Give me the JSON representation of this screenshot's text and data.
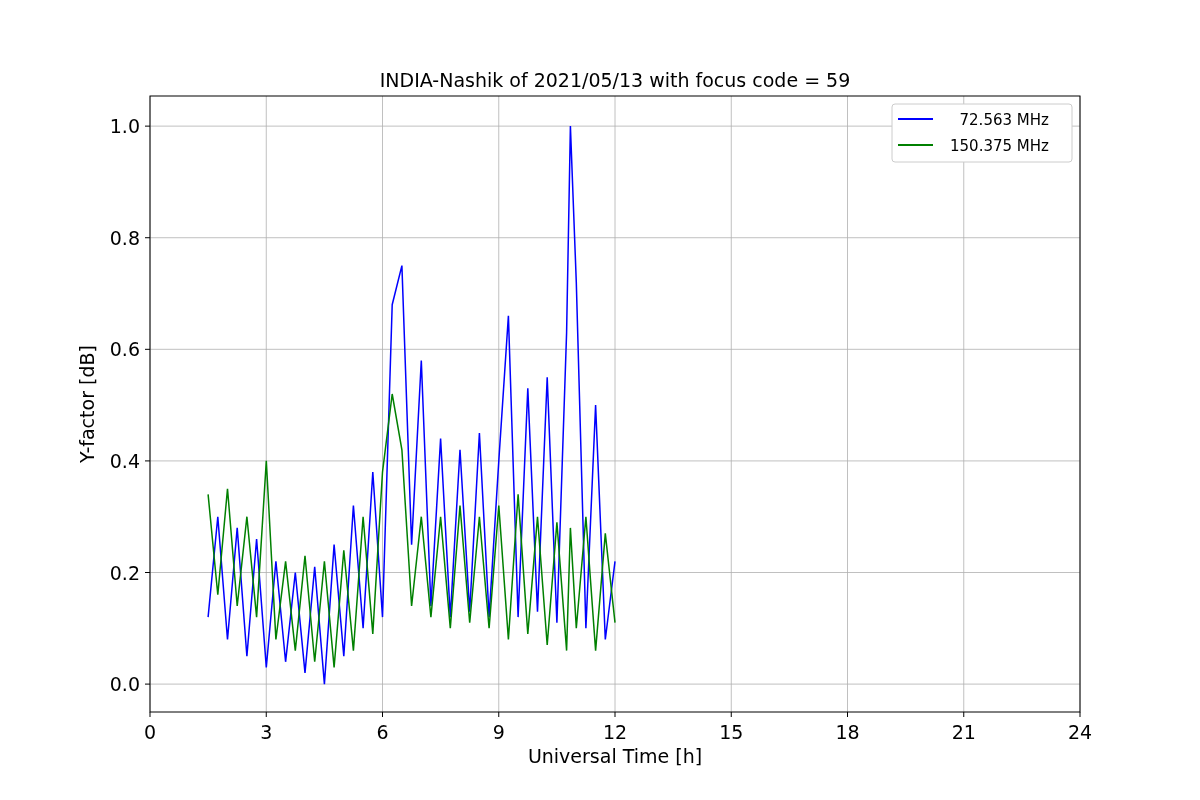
{
  "figure": {
    "chart_data": {
      "type": "line",
      "title": "INDIA-Nashik of 2021/05/13 with focus code = 59",
      "xlabel": "Universal Time [h]",
      "ylabel": "Y-factor [dB]",
      "x": [
        1.5,
        1.75,
        2.0,
        2.25,
        2.5,
        2.75,
        3.0,
        3.25,
        3.5,
        3.75,
        4.0,
        4.25,
        4.5,
        4.75,
        5.0,
        5.25,
        5.5,
        5.75,
        6.0,
        6.25,
        6.5,
        6.75,
        7.0,
        7.25,
        7.5,
        7.75,
        8.0,
        8.25,
        8.5,
        8.75,
        9.0,
        9.25,
        9.5,
        9.75,
        10.0,
        10.25,
        10.5,
        10.75,
        10.85,
        11.0,
        11.25,
        11.5,
        11.75,
        12.0
      ],
      "series": [
        {
          "name": "  72.563 MHz",
          "color": "#0000ff",
          "values": [
            0.12,
            0.3,
            0.08,
            0.28,
            0.05,
            0.26,
            0.03,
            0.22,
            0.04,
            0.2,
            0.02,
            0.21,
            0.0,
            0.25,
            0.05,
            0.32,
            0.1,
            0.38,
            0.12,
            0.68,
            0.75,
            0.25,
            0.58,
            0.14,
            0.44,
            0.12,
            0.42,
            0.13,
            0.45,
            0.12,
            0.4,
            0.66,
            0.12,
            0.53,
            0.13,
            0.55,
            0.11,
            0.63,
            1.0,
            0.72,
            0.1,
            0.5,
            0.08,
            0.22
          ]
        },
        {
          "name": "150.375 MHz",
          "color": "#008000",
          "values": [
            0.34,
            0.16,
            0.35,
            0.14,
            0.3,
            0.12,
            0.4,
            0.08,
            0.22,
            0.06,
            0.23,
            0.04,
            0.22,
            0.03,
            0.24,
            0.06,
            0.3,
            0.09,
            0.38,
            0.52,
            0.42,
            0.14,
            0.3,
            0.12,
            0.3,
            0.1,
            0.32,
            0.11,
            0.3,
            0.1,
            0.32,
            0.08,
            0.34,
            0.09,
            0.3,
            0.07,
            0.29,
            0.06,
            0.28,
            0.1,
            0.3,
            0.06,
            0.27,
            0.11
          ]
        }
      ],
      "grid": true,
      "legend": "upper right",
      "xlim": [
        0,
        24
      ],
      "ylim": [
        -0.05,
        1.054
      ],
      "xticks": [
        0,
        3,
        6,
        9,
        12,
        15,
        18,
        21,
        24
      ],
      "yticks": [
        {
          "value": 0,
          "label": "0.0"
        },
        {
          "value": 0.2,
          "label": "0.2"
        },
        {
          "value": 0.4,
          "label": "0.4"
        },
        {
          "value": 0.6,
          "label": "0.6"
        },
        {
          "value": 0.8,
          "label": "0.8"
        },
        {
          "value": 1.0,
          "label": "1.0"
        }
      ]
    }
  }
}
